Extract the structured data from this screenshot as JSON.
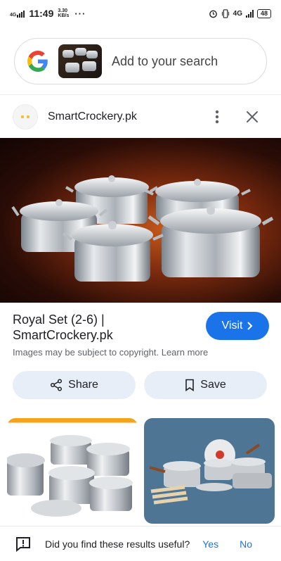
{
  "status_bar": {
    "network": "4G",
    "time": "11:49",
    "speed_value": "3.30",
    "speed_unit": "KB/s",
    "overflow": "···",
    "network_right": "4G",
    "battery": "48"
  },
  "search": {
    "placeholder": "Add to your search"
  },
  "result": {
    "site_name": "SmartCrockery.pk",
    "title": "Royal Set (2-6) | SmartCrockery.pk",
    "visit_label": "Visit",
    "copyright_text": "Images may be subject to copyright. Learn more",
    "share_label": "Share",
    "save_label": "Save"
  },
  "feedback": {
    "question": "Did you find these results useful?",
    "yes": "Yes",
    "no": "No"
  },
  "colors": {
    "accent": "#1a73e8",
    "pill_bg": "#e8eef7"
  }
}
